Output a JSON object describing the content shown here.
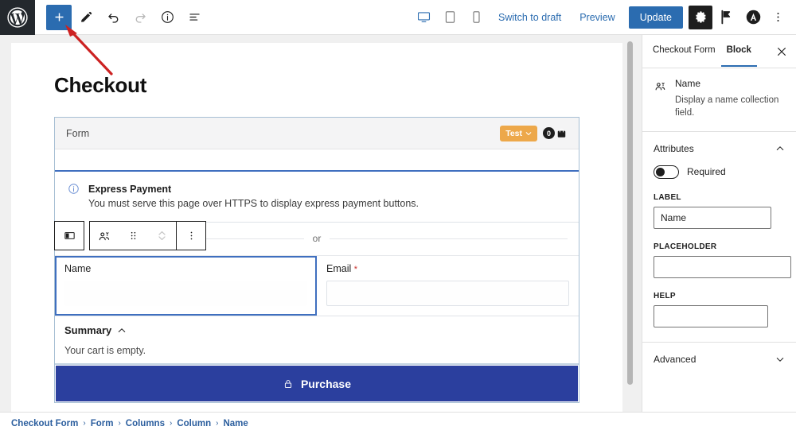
{
  "topbar": {
    "logo_icon": "wordpress-logo-icon",
    "left_tools": [
      {
        "name": "add-block-button",
        "icon": "plus-icon",
        "state": "primary"
      },
      {
        "name": "edit-tool-button",
        "icon": "pencil-icon",
        "state": "normal"
      },
      {
        "name": "undo-button",
        "icon": "undo-arrow-icon",
        "state": "normal"
      },
      {
        "name": "redo-button",
        "icon": "redo-arrow-icon",
        "state": "disabled"
      },
      {
        "name": "details-button",
        "icon": "info-circle-icon",
        "state": "normal"
      },
      {
        "name": "list-view-button",
        "icon": "list-view-icon",
        "state": "normal"
      }
    ],
    "devices": [
      {
        "name": "desktop-view-button",
        "icon": "desktop-icon",
        "active": true
      },
      {
        "name": "tablet-view-button",
        "icon": "tablet-icon",
        "active": false
      },
      {
        "name": "mobile-view-button",
        "icon": "mobile-icon",
        "active": false
      }
    ],
    "switch_to_draft_label": "Switch to draft",
    "preview_label": "Preview",
    "update_label": "Update",
    "settings_icon": "gear-icon",
    "plugin_icon": "flag-plugin-icon",
    "account_icon": "circle-a-avatar-icon",
    "more_icon": "kebab-menu-icon"
  },
  "editor": {
    "page_title": "Checkout",
    "form_block": {
      "header_label": "Form",
      "test_button_label": "Test",
      "test_button_color": "#eda84a",
      "cart_count": "0",
      "cart_icon": "shopping-bag-icon"
    },
    "express_notice": {
      "icon": "info-circle-icon",
      "title": "Express Payment",
      "message": "You must serve this page over HTTPS to display express payment buttons."
    },
    "or_divider_label": "or",
    "block_toolbar": [
      {
        "name": "block-layout-button",
        "icon": "columns-layout-icon"
      },
      {
        "name": "block-type-button",
        "icon": "name-people-icon"
      },
      {
        "name": "drag-handle",
        "icon": "drag-dots-icon"
      },
      {
        "name": "move-updown-button",
        "icon": "chevron-updown-icon"
      },
      {
        "name": "block-options-button",
        "icon": "kebab-menu-icon"
      }
    ],
    "fields": [
      {
        "name": "name-field",
        "label": "Name",
        "required": false,
        "selected": true,
        "value": ""
      },
      {
        "name": "email-field",
        "label": "Email",
        "required": true,
        "selected": false,
        "value": ""
      }
    ],
    "required_marker": "*",
    "summary": {
      "title": "Summary",
      "chevron": "chevron-up-icon",
      "body": "Your cart is empty."
    },
    "purchase_button": {
      "label": "Purchase",
      "icon": "lock-icon",
      "color": "#2b3f9e"
    }
  },
  "sidebar": {
    "tabs": [
      {
        "name": "tab-checkout-form",
        "label": "Checkout Form",
        "active": false
      },
      {
        "name": "tab-block",
        "label": "Block",
        "active": true
      }
    ],
    "close_icon": "close-icon",
    "block_info": {
      "icon": "name-people-icon",
      "name": "Name",
      "description": "Display a name collection field."
    },
    "attributes": {
      "section_title": "Attributes",
      "expanded": true,
      "chevron": "chevron-up-icon",
      "required_toggle": {
        "label": "Required",
        "value": false
      },
      "label_field": {
        "label": "LABEL",
        "value": "Name",
        "placeholder": ""
      },
      "placeholder_field": {
        "label": "PLACEHOLDER",
        "value": "",
        "placeholder": ""
      },
      "help_field": {
        "label": "HELP",
        "value": "",
        "placeholder": ""
      }
    },
    "advanced": {
      "section_title": "Advanced",
      "expanded": false,
      "chevron": "chevron-down-icon"
    }
  },
  "breadcrumb": {
    "separator": "›",
    "items": [
      {
        "name": "breadcrumb-checkout-form",
        "label": "Checkout Form"
      },
      {
        "name": "breadcrumb-form",
        "label": "Form"
      },
      {
        "name": "breadcrumb-columns",
        "label": "Columns"
      },
      {
        "name": "breadcrumb-column",
        "label": "Column"
      },
      {
        "name": "breadcrumb-name",
        "label": "Name"
      }
    ]
  },
  "annotation": {
    "arrow_color": "#cc2222",
    "points_to": "add-block-button"
  }
}
